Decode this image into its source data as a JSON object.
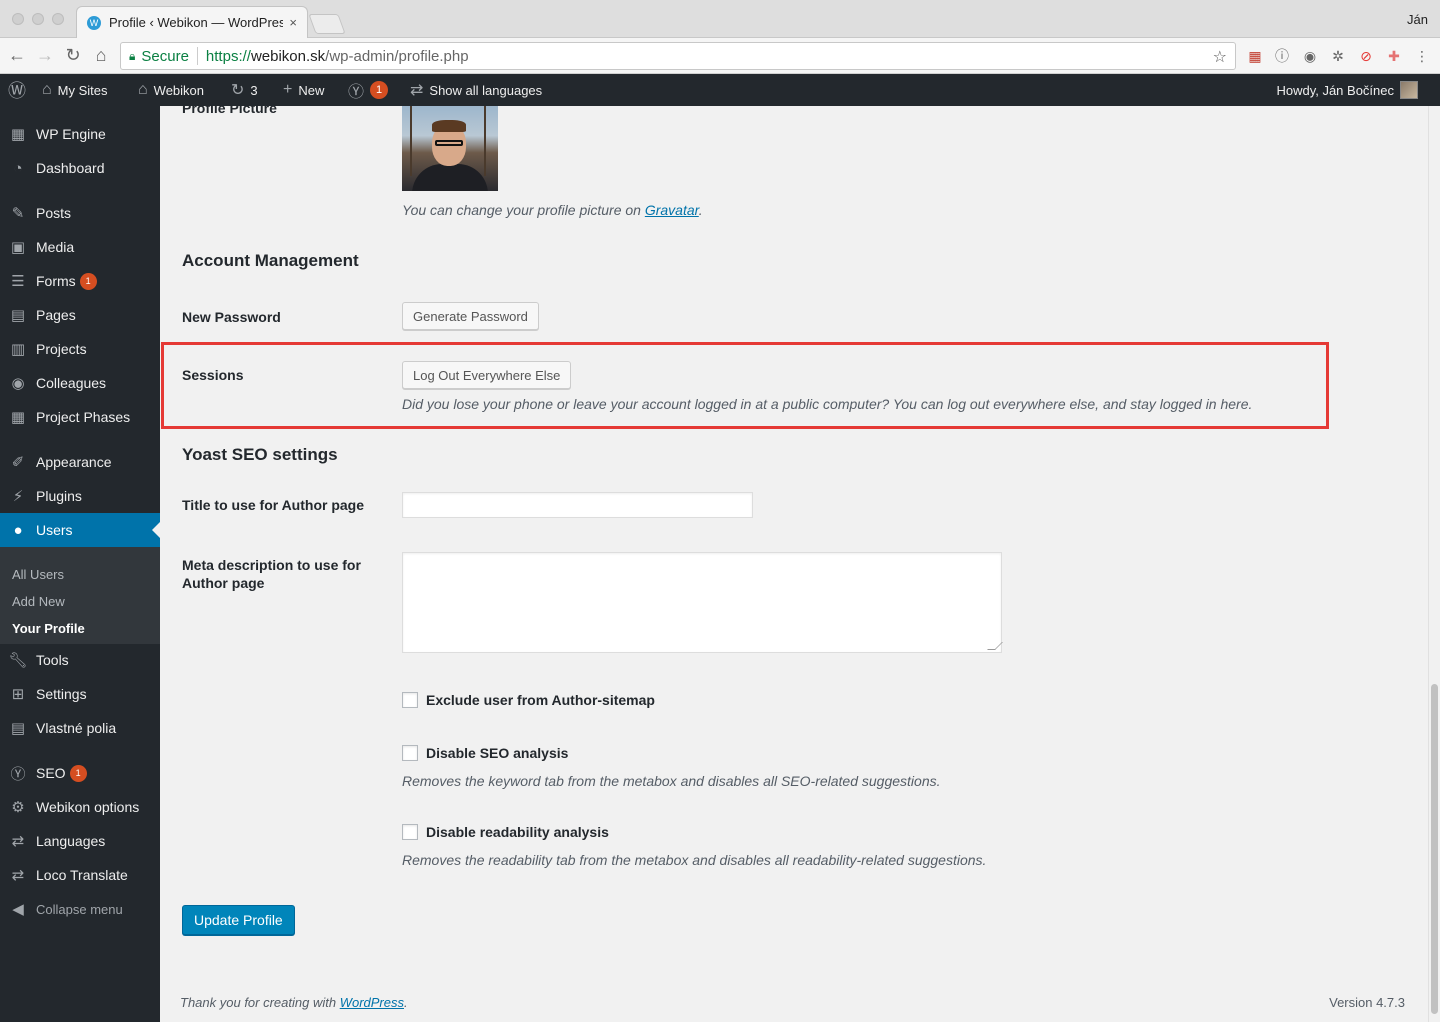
{
  "browser": {
    "tab_title": "Profile ‹ Webikon — WordPres",
    "tab_close": "×",
    "profile_name": "Ján",
    "secure_label": "Secure",
    "url_scheme": "https://",
    "url_host": "webikon.sk",
    "url_path": "/wp-admin/profile.php"
  },
  "adminbar": {
    "my_sites": "My Sites",
    "site_name": "Webikon",
    "updates_count": "3",
    "new_label": "New",
    "yoast_count": "1",
    "languages_label": "Show all languages",
    "howdy": "Howdy, Ján Bočínec"
  },
  "sidebar": {
    "items": [
      {
        "label": "WP Engine",
        "icon": "grid-icon"
      },
      {
        "label": "Dashboard",
        "icon": "dashboard-icon"
      },
      {
        "label": "Posts",
        "icon": "pin-icon"
      },
      {
        "label": "Media",
        "icon": "media-icon"
      },
      {
        "label": "Forms",
        "icon": "forms-icon",
        "badge": "1"
      },
      {
        "label": "Pages",
        "icon": "pages-icon"
      },
      {
        "label": "Projects",
        "icon": "projects-icon"
      },
      {
        "label": "Colleagues",
        "icon": "colleagues-icon"
      },
      {
        "label": "Project Phases",
        "icon": "phases-icon"
      },
      {
        "label": "Appearance",
        "icon": "brush-icon"
      },
      {
        "label": "Plugins",
        "icon": "plug-icon"
      },
      {
        "label": "Users",
        "icon": "user-icon"
      },
      {
        "label": "Tools",
        "icon": "wrench-icon"
      },
      {
        "label": "Settings",
        "icon": "settings-icon"
      },
      {
        "label": "Vlastné polia",
        "icon": "fields-icon"
      },
      {
        "label": "SEO",
        "icon": "yoast-icon",
        "badge": "1"
      },
      {
        "label": "Webikon options",
        "icon": "gear-icon"
      },
      {
        "label": "Languages",
        "icon": "translate-icon"
      },
      {
        "label": "Loco Translate",
        "icon": "translate-icon"
      },
      {
        "label": "Collapse menu",
        "icon": "collapse-icon"
      }
    ],
    "submenu": [
      "All Users",
      "Add New",
      "Your Profile"
    ]
  },
  "profile": {
    "picture_label": "Profile Picture",
    "picture_desc": "You can change your profile picture on ",
    "gravatar_link": "Gravatar",
    "period": ".",
    "account_heading": "Account Management",
    "new_password_label": "New Password",
    "generate_password_btn": "Generate Password",
    "sessions_label": "Sessions",
    "logout_btn": "Log Out Everywhere Else",
    "sessions_desc": "Did you lose your phone or leave your account logged in at a public computer? You can log out everywhere else, and stay logged in here.",
    "yoast_heading": "Yoast SEO settings",
    "title_label": "Title to use for Author page",
    "meta_label_1": "Meta description to use for",
    "meta_label_2": "Author page",
    "exclude_sitemap": "Exclude user from Author-sitemap",
    "disable_seo": "Disable SEO analysis",
    "disable_seo_desc": "Removes the keyword tab from the metabox and disables all SEO-related suggestions.",
    "disable_readability": "Disable readability analysis",
    "disable_readability_desc": "Removes the readability tab from the metabox and disables all readability-related suggestions.",
    "update_btn": "Update Profile"
  },
  "footer": {
    "thanks": "Thank you for creating with ",
    "wp_link": "WordPress",
    "period": ".",
    "version": "Version 4.7.3"
  }
}
